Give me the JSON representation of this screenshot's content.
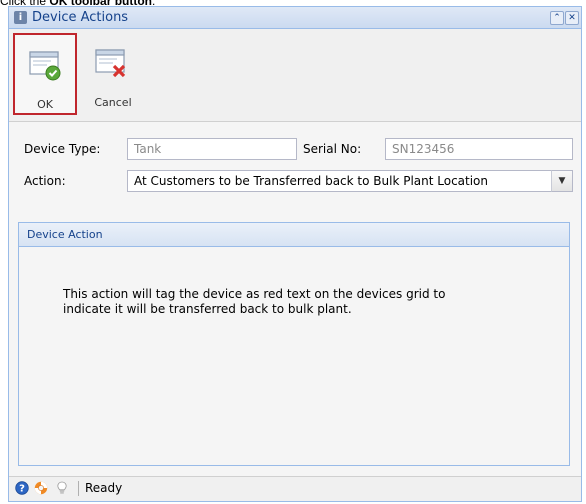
{
  "caption": {
    "prefix": "Click the ",
    "bold": "OK toolbar button",
    "suffix": "."
  },
  "window": {
    "title": "Device Actions",
    "tools": {
      "collapse": "⌃",
      "close": "✕"
    }
  },
  "toolbar": {
    "ok_label": "OK",
    "cancel_label": "Cancel",
    "ok_icon": "window-check-icon",
    "cancel_icon": "window-cancel-icon"
  },
  "form": {
    "device_type_label": "Device Type:",
    "device_type_value": "Tank",
    "serial_no_label": "Serial No:",
    "serial_no_value": "SN123456",
    "action_label": "Action:",
    "action_value": "At Customers to be Transferred back to Bulk Plant Location"
  },
  "panel": {
    "title": "Device Action",
    "line1": "This action will tag the device as red text on the devices grid to",
    "line2": "indicate it will be transferred back to bulk plant."
  },
  "status": {
    "text": "Ready",
    "icons": [
      "help-icon",
      "lifebuoy-icon",
      "lightbulb-icon"
    ]
  },
  "colors": {
    "accent_border": "#99bbe8",
    "title_text": "#15428b",
    "selected_border": "#c0262d"
  }
}
